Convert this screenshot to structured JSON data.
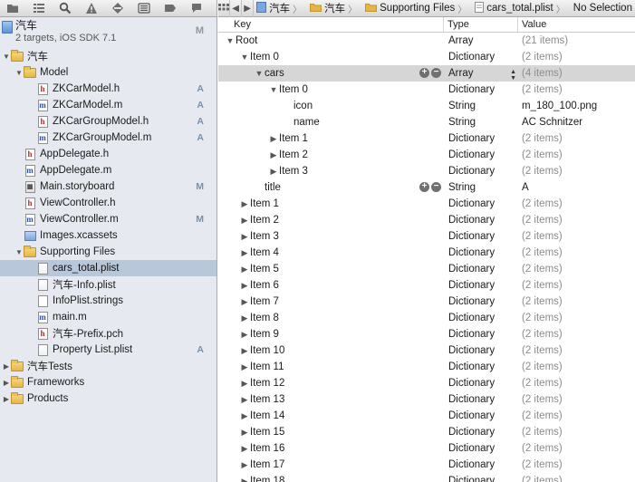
{
  "navigator": {
    "toolbar_icons": [
      "folder-icon",
      "structure-icon",
      "search-icon",
      "warning-icon",
      "test-icon",
      "debug-icon",
      "breakpoint-icon",
      "log-icon"
    ],
    "project": {
      "name": "汽车",
      "subtitle": "2 targets, iOS SDK 7.1",
      "status": "M"
    },
    "items": [
      {
        "label": "汽车",
        "kind": "folder",
        "level": 0,
        "disclosure": "open",
        "status": ""
      },
      {
        "label": "Model",
        "kind": "folder",
        "level": 1,
        "disclosure": "open",
        "status": ""
      },
      {
        "label": "ZKCarModel.h",
        "kind": "h",
        "level": 2,
        "disclosure": "",
        "status": "A"
      },
      {
        "label": "ZKCarModel.m",
        "kind": "m",
        "level": 2,
        "disclosure": "",
        "status": "A"
      },
      {
        "label": "ZKCarGroupModel.h",
        "kind": "h",
        "level": 2,
        "disclosure": "",
        "status": "A"
      },
      {
        "label": "ZKCarGroupModel.m",
        "kind": "m",
        "level": 2,
        "disclosure": "",
        "status": "A"
      },
      {
        "label": "AppDelegate.h",
        "kind": "h",
        "level": 1,
        "disclosure": "",
        "status": ""
      },
      {
        "label": "AppDelegate.m",
        "kind": "m",
        "level": 1,
        "disclosure": "",
        "status": ""
      },
      {
        "label": "Main.storyboard",
        "kind": "story",
        "level": 1,
        "disclosure": "",
        "status": "M"
      },
      {
        "label": "ViewController.h",
        "kind": "h",
        "level": 1,
        "disclosure": "",
        "status": ""
      },
      {
        "label": "ViewController.m",
        "kind": "m",
        "level": 1,
        "disclosure": "",
        "status": "M"
      },
      {
        "label": "Images.xcassets",
        "kind": "assets",
        "level": 1,
        "disclosure": "",
        "status": ""
      },
      {
        "label": "Supporting Files",
        "kind": "folder",
        "level": 1,
        "disclosure": "open",
        "status": ""
      },
      {
        "label": "cars_total.plist",
        "kind": "plist",
        "level": 2,
        "disclosure": "",
        "status": "",
        "selected": true
      },
      {
        "label": "汽车-Info.plist",
        "kind": "plist",
        "level": 2,
        "disclosure": "",
        "status": ""
      },
      {
        "label": "InfoPlist.strings",
        "kind": "plain",
        "level": 2,
        "disclosure": "",
        "status": ""
      },
      {
        "label": "main.m",
        "kind": "m",
        "level": 2,
        "disclosure": "",
        "status": ""
      },
      {
        "label": "汽车-Prefix.pch",
        "kind": "h",
        "level": 2,
        "disclosure": "",
        "status": ""
      },
      {
        "label": "Property List.plist",
        "kind": "plist",
        "level": 2,
        "disclosure": "",
        "status": "A"
      },
      {
        "label": "汽车Tests",
        "kind": "folder",
        "level": 0,
        "disclosure": "closed",
        "status": ""
      },
      {
        "label": "Frameworks",
        "kind": "folder",
        "level": 0,
        "disclosure": "closed",
        "status": ""
      },
      {
        "label": "Products",
        "kind": "folder",
        "level": 0,
        "disclosure": "closed",
        "status": ""
      }
    ]
  },
  "jumpbar": {
    "crumbs": [
      {
        "label": "汽车",
        "icon": "project-icon"
      },
      {
        "label": "汽车",
        "icon": "folder-icon"
      },
      {
        "label": "Supporting Files",
        "icon": "folder-icon"
      },
      {
        "label": "cars_total.plist",
        "icon": "plist-file-icon"
      },
      {
        "label": "No Selection",
        "icon": ""
      }
    ]
  },
  "plist": {
    "columns": {
      "key": "Key",
      "type": "Type",
      "value": "Value"
    },
    "rows": [
      {
        "key": "Root",
        "level": 0,
        "disclosure": "open",
        "type": "Array",
        "value": "(21 items)",
        "muted": true
      },
      {
        "key": "Item 0",
        "level": 1,
        "disclosure": "open",
        "type": "Dictionary",
        "value": "(2 items)",
        "muted": true
      },
      {
        "key": "cars",
        "level": 2,
        "disclosure": "open",
        "type": "Array",
        "value": "(4 items)",
        "muted": true,
        "highlight": true
      },
      {
        "key": "Item 0",
        "level": 3,
        "disclosure": "open",
        "type": "Dictionary",
        "value": "(2 items)",
        "muted": true
      },
      {
        "key": "icon",
        "level": 4,
        "disclosure": "",
        "type": "String",
        "value": "m_180_100.png",
        "muted": false
      },
      {
        "key": "name",
        "level": 4,
        "disclosure": "",
        "type": "String",
        "value": "AC Schnitzer",
        "muted": false
      },
      {
        "key": "Item 1",
        "level": 3,
        "disclosure": "closed",
        "type": "Dictionary",
        "value": "(2 items)",
        "muted": true
      },
      {
        "key": "Item 2",
        "level": 3,
        "disclosure": "closed",
        "type": "Dictionary",
        "value": "(2 items)",
        "muted": true
      },
      {
        "key": "Item 3",
        "level": 3,
        "disclosure": "closed",
        "type": "Dictionary",
        "value": "(2 items)",
        "muted": true
      },
      {
        "key": "title",
        "level": 2,
        "disclosure": "",
        "type": "String",
        "value": "A",
        "muted": false,
        "controls": true
      },
      {
        "key": "Item 1",
        "level": 1,
        "disclosure": "closed",
        "type": "Dictionary",
        "value": "(2 items)",
        "muted": true
      },
      {
        "key": "Item 2",
        "level": 1,
        "disclosure": "closed",
        "type": "Dictionary",
        "value": "(2 items)",
        "muted": true
      },
      {
        "key": "Item 3",
        "level": 1,
        "disclosure": "closed",
        "type": "Dictionary",
        "value": "(2 items)",
        "muted": true
      },
      {
        "key": "Item 4",
        "level": 1,
        "disclosure": "closed",
        "type": "Dictionary",
        "value": "(2 items)",
        "muted": true
      },
      {
        "key": "Item 5",
        "level": 1,
        "disclosure": "closed",
        "type": "Dictionary",
        "value": "(2 items)",
        "muted": true
      },
      {
        "key": "Item 6",
        "level": 1,
        "disclosure": "closed",
        "type": "Dictionary",
        "value": "(2 items)",
        "muted": true
      },
      {
        "key": "Item 7",
        "level": 1,
        "disclosure": "closed",
        "type": "Dictionary",
        "value": "(2 items)",
        "muted": true
      },
      {
        "key": "Item 8",
        "level": 1,
        "disclosure": "closed",
        "type": "Dictionary",
        "value": "(2 items)",
        "muted": true
      },
      {
        "key": "Item 9",
        "level": 1,
        "disclosure": "closed",
        "type": "Dictionary",
        "value": "(2 items)",
        "muted": true
      },
      {
        "key": "Item 10",
        "level": 1,
        "disclosure": "closed",
        "type": "Dictionary",
        "value": "(2 items)",
        "muted": true
      },
      {
        "key": "Item 11",
        "level": 1,
        "disclosure": "closed",
        "type": "Dictionary",
        "value": "(2 items)",
        "muted": true
      },
      {
        "key": "Item 12",
        "level": 1,
        "disclosure": "closed",
        "type": "Dictionary",
        "value": "(2 items)",
        "muted": true
      },
      {
        "key": "Item 13",
        "level": 1,
        "disclosure": "closed",
        "type": "Dictionary",
        "value": "(2 items)",
        "muted": true
      },
      {
        "key": "Item 14",
        "level": 1,
        "disclosure": "closed",
        "type": "Dictionary",
        "value": "(2 items)",
        "muted": true
      },
      {
        "key": "Item 15",
        "level": 1,
        "disclosure": "closed",
        "type": "Dictionary",
        "value": "(2 items)",
        "muted": true
      },
      {
        "key": "Item 16",
        "level": 1,
        "disclosure": "closed",
        "type": "Dictionary",
        "value": "(2 items)",
        "muted": true
      },
      {
        "key": "Item 17",
        "level": 1,
        "disclosure": "closed",
        "type": "Dictionary",
        "value": "(2 items)",
        "muted": true
      },
      {
        "key": "Item 18",
        "level": 1,
        "disclosure": "closed",
        "type": "Dictionary",
        "value": "(2 items)",
        "muted": true
      }
    ]
  },
  "colors": {
    "navigator_bg": "#e6eaf0",
    "selection": "#b9c7db",
    "row_highlight": "#d6d6d6",
    "muted_value": "#8c8c8c"
  }
}
